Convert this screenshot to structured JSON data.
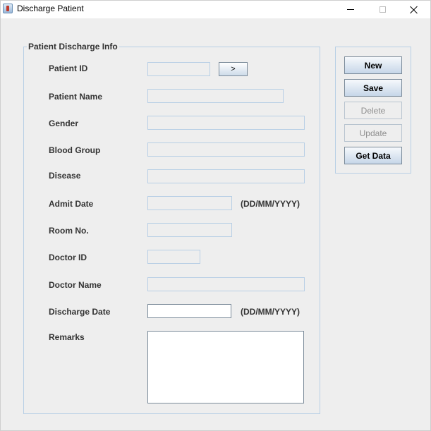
{
  "window": {
    "title": "Discharge Patient"
  },
  "group": {
    "title": "Patient Discharge Info"
  },
  "form": {
    "patient_id_label": "Patient ID",
    "patient_id_value": "",
    "lookup_button_label": ">",
    "patient_name_label": "Patient Name",
    "patient_name_value": "",
    "gender_label": "Gender",
    "gender_value": "",
    "blood_group_label": "Blood Group",
    "blood_group_value": "",
    "disease_label": "Disease",
    "disease_value": "",
    "admit_date_label": "Admit Date",
    "admit_date_value": "",
    "admit_date_hint": "(DD/MM/YYYY)",
    "room_no_label": "Room No.",
    "room_no_value": "",
    "doctor_id_label": "Doctor ID",
    "doctor_id_value": "",
    "doctor_name_label": "Doctor Name",
    "doctor_name_value": "",
    "discharge_date_label": "Discharge Date",
    "discharge_date_value": "",
    "discharge_date_hint": "(DD/MM/YYYY)",
    "remarks_label": "Remarks",
    "remarks_value": ""
  },
  "actions": {
    "new_label": "New",
    "save_label": "Save",
    "delete_label": "Delete",
    "update_label": "Update",
    "get_data_label": "Get Data"
  },
  "icons": {
    "app": "java-cup-icon",
    "minimize": "minimize-icon",
    "maximize": "maximize-icon",
    "close": "close-icon"
  },
  "colors": {
    "window_bg": "#eeeeee",
    "titlebar_bg": "#ffffff",
    "field_border": "#b8cfe5",
    "disabled_text": "#8e8e8e"
  }
}
